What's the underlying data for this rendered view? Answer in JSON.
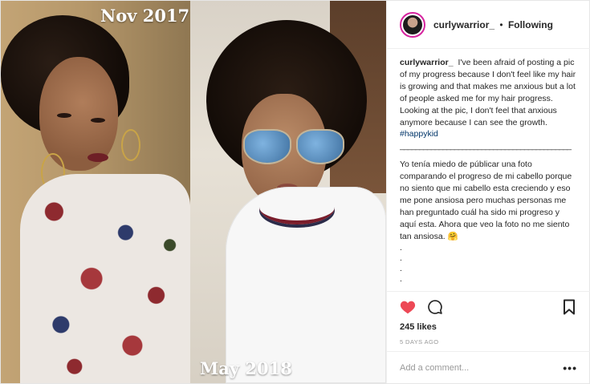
{
  "photo": {
    "label_top": "Nov 2017",
    "label_bottom": "May 2018"
  },
  "header": {
    "username": "curlywarrior_",
    "separator": "•",
    "follow_status": "Following"
  },
  "caption": {
    "username": "curlywarrior_",
    "english_text": "I've been afraid of posting a pic of my progress because I don't feel like my hair is growing and that makes me anxious but a lot of people asked me for my hair progress. Looking at the pic, I don't feel that anxious anymore because I can see the growth.",
    "hashtag": "#happykid",
    "divider": "____________________________________________",
    "spanish_text": "Yo tenía miedo de públicar una foto comparando el progreso de mi cabello porque no siento que mi cabello esta creciendo y eso me pone ansiosa pero muchas personas me han preguntado cuál ha sido mi progreso y aquí esta. Ahora que veo la foto no me siento tan ansiosa. 🤗",
    "dots": [
      ".",
      ".",
      ".",
      "."
    ]
  },
  "actions": {
    "like_icon": "heart-icon",
    "comment_icon": "comment-bubble-icon",
    "save_icon": "bookmark-icon",
    "like_color": "#ed4956"
  },
  "stats": {
    "likes": "245 likes",
    "timestamp": "5 DAYS AGO"
  },
  "comment_box": {
    "placeholder": "Add a comment...",
    "more_label": "•••"
  }
}
